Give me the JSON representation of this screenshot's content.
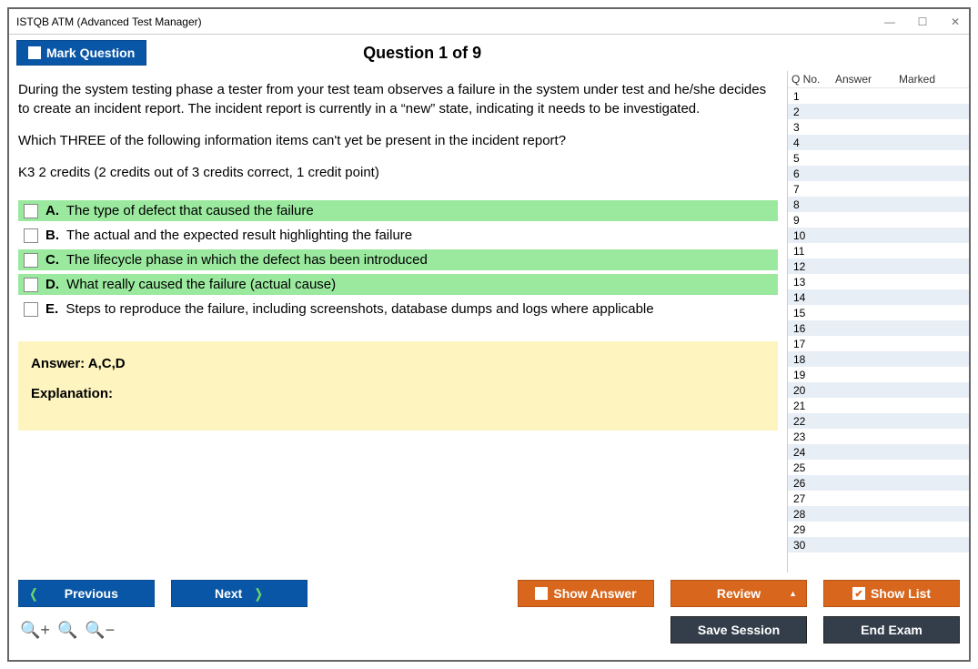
{
  "window": {
    "title": "ISTQB ATM (Advanced Test Manager)"
  },
  "header": {
    "mark_label": "Mark Question",
    "question_label": "Question 1 of 9"
  },
  "question": {
    "p1": "During the system testing phase a tester from your test team observes a failure in the system under test and he/she decides to create an incident report. The incident report is currently in a “new” state, indicating it needs to be investigated.",
    "p2": "Which THREE of the following information items can't yet be present in the incident report?",
    "p3": "K3 2 credits (2 credits out of 3 credits correct, 1 credit point)"
  },
  "options": [
    {
      "letter": "A.",
      "text": "The type of defect that caused the failure",
      "correct": true
    },
    {
      "letter": "B.",
      "text": "The actual and the expected result highlighting the failure",
      "correct": false
    },
    {
      "letter": "C.",
      "text": "The lifecycle phase in which the defect has been introduced",
      "correct": true
    },
    {
      "letter": "D.",
      "text": "What really caused the failure (actual cause)",
      "correct": true
    },
    {
      "letter": "E.",
      "text": "Steps to reproduce the failure, including screenshots, database dumps and logs where applicable",
      "correct": false
    }
  ],
  "answer_panel": {
    "answer_label": "Answer: A,C,D",
    "explanation_label": "Explanation:"
  },
  "sidebar": {
    "col_qno": "Q No.",
    "col_answer": "Answer",
    "col_marked": "Marked",
    "rows": [
      1,
      2,
      3,
      4,
      5,
      6,
      7,
      8,
      9,
      10,
      11,
      12,
      13,
      14,
      15,
      16,
      17,
      18,
      19,
      20,
      21,
      22,
      23,
      24,
      25,
      26,
      27,
      28,
      29,
      30
    ]
  },
  "footer": {
    "previous": "Previous",
    "next": "Next",
    "show_answer": "Show Answer",
    "review": "Review",
    "show_list": "Show List",
    "save_session": "Save Session",
    "end_exam": "End Exam"
  }
}
